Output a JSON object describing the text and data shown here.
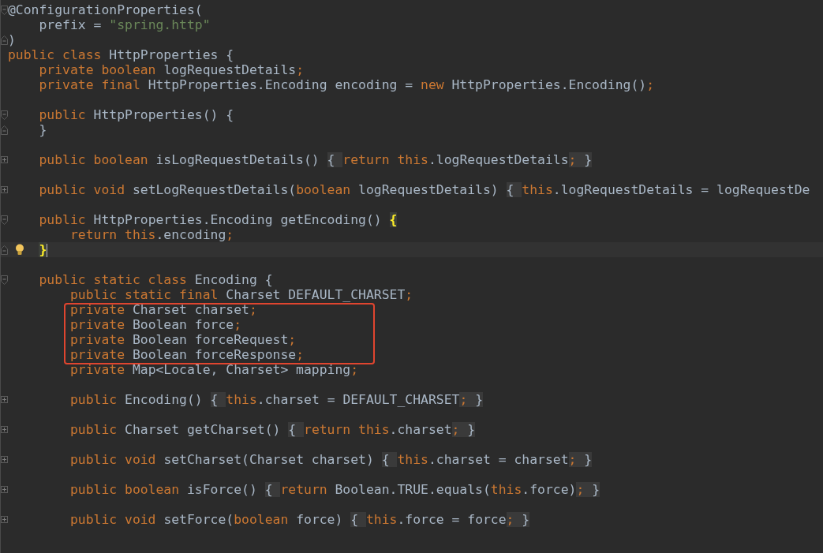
{
  "editor": {
    "lines": [
      {
        "kind": "code",
        "fold_marker": {
          "kind": "start"
        },
        "current": false,
        "bulb": false,
        "tokens": [
          {
            "kind": "text",
            "text": "@ConfigurationProperties("
          }
        ]
      },
      {
        "kind": "code",
        "current": false,
        "bulb": false,
        "tokens": [
          {
            "kind": "text",
            "text": "    prefix = "
          },
          {
            "kind": "string",
            "text": "\"spring.http\""
          }
        ]
      },
      {
        "kind": "code",
        "fold_marker": {
          "kind": "end"
        },
        "current": false,
        "bulb": false,
        "tokens": [
          {
            "kind": "text",
            "text": ")"
          }
        ]
      },
      {
        "kind": "code",
        "current": false,
        "bulb": false,
        "tokens": [
          {
            "kind": "keyword",
            "text": "public class "
          },
          {
            "kind": "text",
            "text": "HttpProperties {"
          }
        ]
      },
      {
        "kind": "code",
        "current": false,
        "bulb": false,
        "tokens": [
          {
            "kind": "keyword",
            "text": "    private boolean "
          },
          {
            "kind": "text",
            "text": "logRequestDetails"
          },
          {
            "kind": "keyword",
            "text": ";"
          }
        ]
      },
      {
        "kind": "code",
        "current": false,
        "bulb": false,
        "tokens": [
          {
            "kind": "keyword",
            "text": "    private final "
          },
          {
            "kind": "text",
            "text": "HttpProperties.Encoding encoding = "
          },
          {
            "kind": "keyword",
            "text": "new "
          },
          {
            "kind": "text",
            "text": "HttpProperties.Encoding()"
          },
          {
            "kind": "keyword",
            "text": ";"
          }
        ]
      },
      {
        "kind": "blank"
      },
      {
        "kind": "code",
        "fold_marker": {
          "kind": "start"
        },
        "current": false,
        "bulb": false,
        "tokens": [
          {
            "kind": "keyword",
            "text": "    public "
          },
          {
            "kind": "text",
            "text": "HttpProperties() {"
          }
        ]
      },
      {
        "kind": "code",
        "fold_marker": {
          "kind": "end"
        },
        "current": false,
        "bulb": false,
        "tokens": [
          {
            "kind": "text",
            "text": "    }"
          }
        ]
      },
      {
        "kind": "blank"
      },
      {
        "kind": "code",
        "fold_marker": {
          "kind": "collapsed"
        },
        "current": false,
        "bulb": false,
        "tokens": [
          {
            "kind": "keyword",
            "text": "    public boolean "
          },
          {
            "kind": "text",
            "text": "isLogRequestDetails() "
          },
          {
            "kind": "fold",
            "text": "{ "
          },
          {
            "kind": "keyword",
            "text": "return this"
          },
          {
            "kind": "text",
            "text": ".logRequestDetails"
          },
          {
            "kind": "fold-keyword",
            "text": ";"
          },
          {
            "kind": "fold",
            "text": " }"
          }
        ]
      },
      {
        "kind": "blank"
      },
      {
        "kind": "code",
        "fold_marker": {
          "kind": "collapsed"
        },
        "current": false,
        "bulb": false,
        "tokens": [
          {
            "kind": "keyword",
            "text": "    public void "
          },
          {
            "kind": "text",
            "text": "setLogRequestDetails("
          },
          {
            "kind": "keyword",
            "text": "boolean "
          },
          {
            "kind": "text",
            "text": "logRequestDetails) "
          },
          {
            "kind": "fold",
            "text": "{ "
          },
          {
            "kind": "keyword",
            "text": "this"
          },
          {
            "kind": "text",
            "text": ".logRequestDetails = logRequestDe"
          }
        ]
      },
      {
        "kind": "blank"
      },
      {
        "kind": "code",
        "fold_marker": {
          "kind": "start"
        },
        "current": false,
        "bulb": false,
        "tokens": [
          {
            "kind": "keyword",
            "text": "    public "
          },
          {
            "kind": "text",
            "text": "HttpProperties.Encoding getEncoding() "
          },
          {
            "kind": "brace-match",
            "text": "{"
          }
        ]
      },
      {
        "kind": "code",
        "current": false,
        "bulb": false,
        "tokens": [
          {
            "kind": "keyword",
            "text": "        return this"
          },
          {
            "kind": "text",
            "text": ".encoding"
          },
          {
            "kind": "keyword",
            "text": ";"
          }
        ]
      },
      {
        "kind": "code",
        "fold_marker": {
          "kind": "end"
        },
        "current": true,
        "bulb": true,
        "tokens": [
          {
            "kind": "brace-match",
            "text": "    }"
          }
        ]
      },
      {
        "kind": "blank"
      },
      {
        "kind": "code",
        "fold_marker": {
          "kind": "start"
        },
        "current": false,
        "bulb": false,
        "tokens": [
          {
            "kind": "keyword",
            "text": "    public static class "
          },
          {
            "kind": "text",
            "text": "Encoding {"
          }
        ]
      },
      {
        "kind": "code",
        "current": false,
        "bulb": false,
        "tokens": [
          {
            "kind": "keyword",
            "text": "        public static final "
          },
          {
            "kind": "text",
            "text": "Charset DEFAULT_CHARSET"
          },
          {
            "kind": "keyword",
            "text": ";"
          }
        ]
      },
      {
        "kind": "annotation-box",
        "lines": [
          {
            "kind": "code",
            "tokens": [
              {
                "kind": "keyword",
                "text": "        private "
              },
              {
                "kind": "text",
                "text": "Charset charset"
              },
              {
                "kind": "keyword",
                "text": ";"
              }
            ]
          },
          {
            "kind": "code",
            "tokens": [
              {
                "kind": "keyword",
                "text": "        private "
              },
              {
                "kind": "text",
                "text": "Boolean force"
              },
              {
                "kind": "keyword",
                "text": ";"
              }
            ]
          },
          {
            "kind": "code",
            "tokens": [
              {
                "kind": "keyword",
                "text": "        private "
              },
              {
                "kind": "text",
                "text": "Boolean forceRequest"
              },
              {
                "kind": "keyword",
                "text": ";"
              }
            ]
          },
          {
            "kind": "code",
            "tokens": [
              {
                "kind": "keyword",
                "text": "        private "
              },
              {
                "kind": "text",
                "text": "Boolean forceResponse"
              },
              {
                "kind": "keyword",
                "text": ";"
              }
            ]
          }
        ]
      },
      {
        "kind": "code",
        "current": false,
        "bulb": false,
        "tokens": [
          {
            "kind": "keyword",
            "text": "        private "
          },
          {
            "kind": "text",
            "text": "Map<Locale, Charset> mapping"
          },
          {
            "kind": "keyword",
            "text": ";"
          }
        ]
      },
      {
        "kind": "blank"
      },
      {
        "kind": "code",
        "fold_marker": {
          "kind": "collapsed"
        },
        "current": false,
        "bulb": false,
        "tokens": [
          {
            "kind": "keyword",
            "text": "        public "
          },
          {
            "kind": "text",
            "text": "Encoding() "
          },
          {
            "kind": "fold",
            "text": "{ "
          },
          {
            "kind": "keyword",
            "text": "this"
          },
          {
            "kind": "text",
            "text": ".charset = DEFAULT_CHARSET"
          },
          {
            "kind": "fold-keyword",
            "text": ";"
          },
          {
            "kind": "fold",
            "text": " }"
          }
        ]
      },
      {
        "kind": "blank"
      },
      {
        "kind": "code",
        "fold_marker": {
          "kind": "collapsed"
        },
        "current": false,
        "bulb": false,
        "tokens": [
          {
            "kind": "keyword",
            "text": "        public "
          },
          {
            "kind": "text",
            "text": "Charset getCharset() "
          },
          {
            "kind": "fold",
            "text": "{ "
          },
          {
            "kind": "keyword",
            "text": "return this"
          },
          {
            "kind": "text",
            "text": ".charset"
          },
          {
            "kind": "fold-keyword",
            "text": ";"
          },
          {
            "kind": "fold",
            "text": " }"
          }
        ]
      },
      {
        "kind": "blank"
      },
      {
        "kind": "code",
        "fold_marker": {
          "kind": "collapsed"
        },
        "current": false,
        "bulb": false,
        "tokens": [
          {
            "kind": "keyword",
            "text": "        public void "
          },
          {
            "kind": "text",
            "text": "setCharset(Charset charset) "
          },
          {
            "kind": "fold",
            "text": "{ "
          },
          {
            "kind": "keyword",
            "text": "this"
          },
          {
            "kind": "text",
            "text": ".charset = charset"
          },
          {
            "kind": "fold-keyword",
            "text": ";"
          },
          {
            "kind": "fold",
            "text": " }"
          }
        ]
      },
      {
        "kind": "blank"
      },
      {
        "kind": "code",
        "fold_marker": {
          "kind": "collapsed"
        },
        "current": false,
        "bulb": false,
        "tokens": [
          {
            "kind": "keyword",
            "text": "        public boolean "
          },
          {
            "kind": "text",
            "text": "isForce() "
          },
          {
            "kind": "fold",
            "text": "{ "
          },
          {
            "kind": "keyword",
            "text": "return "
          },
          {
            "kind": "text",
            "text": "Boolean.TRUE.equals("
          },
          {
            "kind": "keyword",
            "text": "this"
          },
          {
            "kind": "text",
            "text": ".force)"
          },
          {
            "kind": "fold-keyword",
            "text": ";"
          },
          {
            "kind": "fold",
            "text": " }"
          }
        ]
      },
      {
        "kind": "blank"
      },
      {
        "kind": "code",
        "fold_marker": {
          "kind": "collapsed"
        },
        "current": false,
        "bulb": false,
        "tokens": [
          {
            "kind": "keyword",
            "text": "        public void "
          },
          {
            "kind": "text",
            "text": "setForce("
          },
          {
            "kind": "keyword",
            "text": "boolean "
          },
          {
            "kind": "text",
            "text": "force) "
          },
          {
            "kind": "fold",
            "text": "{ "
          },
          {
            "kind": "keyword",
            "text": "this"
          },
          {
            "kind": "text",
            "text": ".force = force"
          },
          {
            "kind": "fold-keyword",
            "text": ";"
          },
          {
            "kind": "fold",
            "text": " }"
          }
        ]
      }
    ]
  }
}
